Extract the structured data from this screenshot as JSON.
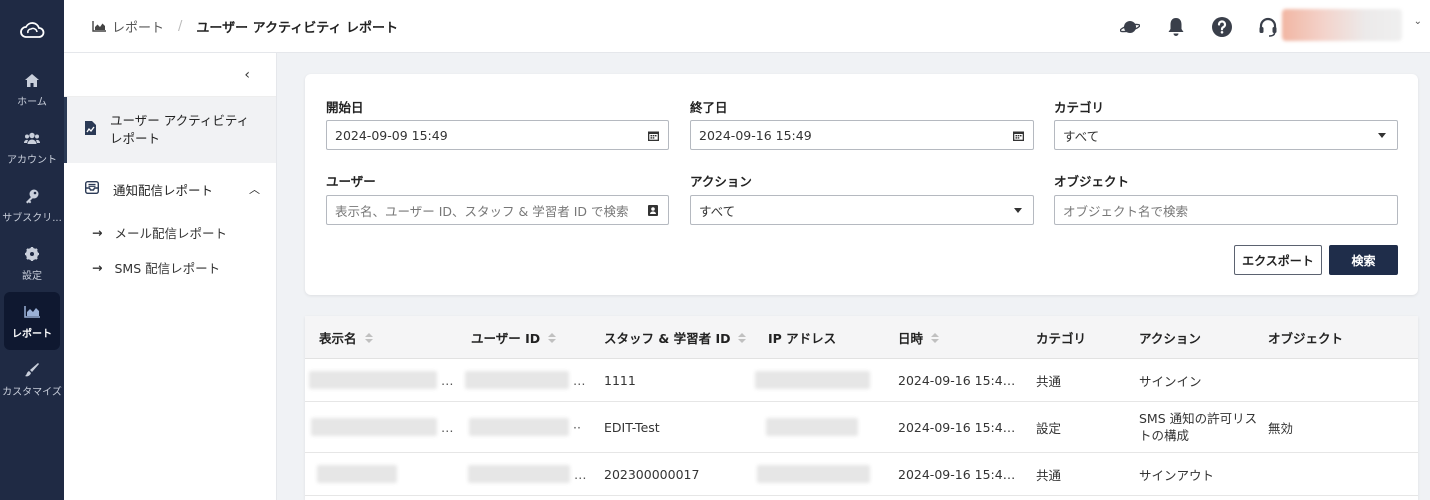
{
  "breadcrumb": {
    "parent": "レポート",
    "current": "ユーザー アクティビティ レポート"
  },
  "rail": [
    {
      "name": "home",
      "label": "ホーム",
      "icon": "home-icon"
    },
    {
      "name": "account",
      "label": "アカウント",
      "icon": "users-icon"
    },
    {
      "name": "subscription",
      "label": "サブスクリ...",
      "icon": "key-icon"
    },
    {
      "name": "settings",
      "label": "設定",
      "icon": "gear-icon"
    },
    {
      "name": "report",
      "label": "レポート",
      "icon": "chart-icon",
      "active": true
    },
    {
      "name": "customize",
      "label": "カスタマイズ",
      "icon": "brush-icon"
    }
  ],
  "subnav": {
    "active_item": "ユーザー アクティビティ レポート",
    "group": "通知配信レポート",
    "links": [
      "メール配信レポート",
      "SMS 配信レポート"
    ]
  },
  "filters": {
    "start_label": "開始日",
    "start_value": "2024-09-09 15:49",
    "end_label": "終了日",
    "end_value": "2024-09-16 15:49",
    "category_label": "カテゴリ",
    "category_value": "すべて",
    "user_label": "ユーザー",
    "user_placeholder": "表示名、ユーザー ID、スタッフ & 学習者 ID で検索",
    "action_label": "アクション",
    "action_value": "すべて",
    "object_label": "オブジェクト",
    "object_placeholder": "オブジェクト名で検索",
    "export_label": "エクスポート",
    "search_label": "検索"
  },
  "table": {
    "headers": {
      "display_name": "表示名",
      "user_id": "ユーザー ID",
      "staff_id": "スタッフ & 学習者 ID",
      "ip": "IP アドレス",
      "datetime": "日時",
      "category": "カテゴリ",
      "action": "アクション",
      "object": "オブジェクト"
    },
    "rows": [
      {
        "staff_id": "1111",
        "datetime": "2024-09-16 15:4…",
        "category": "共通",
        "action": "サインイン",
        "object": ""
      },
      {
        "staff_id": "EDIT-Test",
        "datetime": "2024-09-16 15:4…",
        "category": "設定",
        "action": "SMS 通知の許可リストの構成",
        "object": "無効"
      },
      {
        "staff_id": "202300000017",
        "datetime": "2024-09-16 15:4…",
        "category": "共通",
        "action": "サインアウト",
        "object": ""
      }
    ]
  },
  "colors": {
    "rail": "#1f2a44",
    "primary": "#1f2d4a"
  }
}
